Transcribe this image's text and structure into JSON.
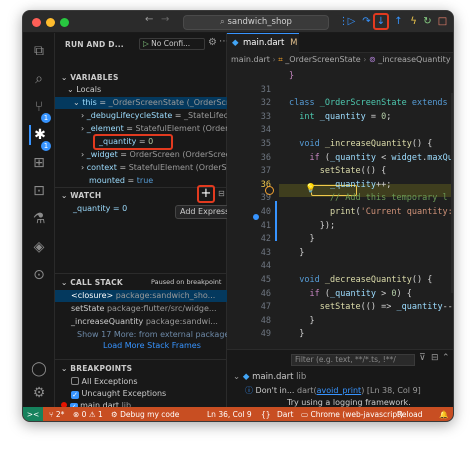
{
  "titlebar": {
    "search_text": "sandwich_shop",
    "nav_back": "←",
    "nav_forward": "→"
  },
  "sidebar": {
    "run_title": "RUN AND D...",
    "config_label": "No Confi...",
    "variables_title": "VARIABLES",
    "locals_label": "Locals",
    "variables": [
      {
        "key": "this",
        "value": "_OrderScreenState (_OrderScr..."
      },
      {
        "key": "_debugLifecycleState",
        "value": "_StateLifec..."
      },
      {
        "key": "_element",
        "value": "StatefulElement (OrderS..."
      },
      {
        "key": "_quantity",
        "value": "0"
      },
      {
        "key": "_widget",
        "value": "OrderScreen (OrderScreen)"
      },
      {
        "key": "context",
        "value": "StatefulElement (OrderScr..."
      },
      {
        "key": "mounted",
        "value": "true"
      }
    ],
    "watch_title": "WATCH",
    "watch_expr": "_quantity = 0",
    "add_expression_tooltip": "Add Expression",
    "callstack_title": "CALL STACK",
    "paused_label": "Paused on breakpoint",
    "frames": [
      {
        "fn": "<closure>",
        "loc": "package:sandwich_sho..."
      },
      {
        "fn": "setState",
        "loc": "package:flutter/src/widge..."
      },
      {
        "fn": "_increaseQuantity",
        "loc": "package:sandwi..."
      }
    ],
    "show_more": "Show 17 More: from external packages",
    "load_more": "Load More Stack Frames",
    "breakpoints_title": "BREAKPOINTS",
    "breakpoints": [
      {
        "label": "All Exceptions",
        "checked": false
      },
      {
        "label": "Uncaught Exceptions",
        "checked": true
      },
      {
        "label": "main.dart",
        "detail": "lib",
        "checked": true
      }
    ]
  },
  "editor": {
    "tab_label": "main.dart",
    "tab_badge": "M",
    "breadcrumbs": [
      "main.dart",
      "_OrderScreenState",
      "_increaseQuantity"
    ],
    "lines": [
      {
        "n": "",
        "html": "<span class='ctl'>}</span>"
      },
      {
        "n": "31",
        "html": ""
      },
      {
        "n": "32",
        "html": "<span class='kw'>class</span> <span class='ty'>_OrderScreenState</span> <span class='kw'>extends</span>"
      },
      {
        "n": "33",
        "html": "  <span class='ty'>int</span> <span class='var'>_quantity</span> = <span class='num'>0</span>;"
      },
      {
        "n": "34",
        "html": ""
      },
      {
        "n": "35",
        "html": "  <span class='kw'>void</span> <span class='fn'>_increaseQuantity</span>() {"
      },
      {
        "n": "36",
        "html": "    <span class='ctl'>if</span> (<span class='var'>_quantity</span> &lt; <span class='var'>widget</span>.<span class='var'>maxQu</span>"
      },
      {
        "n": "37",
        "html": "      <span class='fn'>setState</span>(() {"
      },
      {
        "n": "36",
        "html": "        <span class='var'>_quantity</span>++;"
      },
      {
        "n": "39",
        "html": "        <span class='cmt'>// Add this temporary l</span>"
      },
      {
        "n": "40",
        "html": "        <span class='fn'>print</span>(<span class='str'>'Current quantity:</span>"
      },
      {
        "n": "41",
        "html": "      });"
      },
      {
        "n": "42",
        "html": "    }"
      },
      {
        "n": "43",
        "html": "  }"
      },
      {
        "n": "44",
        "html": ""
      },
      {
        "n": "45",
        "html": "  <span class='kw'>void</span> <span class='fn'>_decreaseQuantity</span>() {"
      },
      {
        "n": "46",
        "html": "    <span class='ctl'>if</span> (<span class='var'>_quantity</span> &gt; <span class='num'>0</span>) {"
      },
      {
        "n": "47",
        "html": "      <span class='fn'>setState</span>(() =&gt; <span class='var'>_quantity</span>--"
      },
      {
        "n": "48",
        "html": "    }"
      },
      {
        "n": "49",
        "html": "  }"
      }
    ]
  },
  "panel": {
    "filter_placeholder": "Filter (e.g. text, **/*.ts, !**/",
    "problem_file": "main.dart",
    "problem_file_detail": "lib",
    "problem_msg": "Don't in...",
    "problem_source": "dart(",
    "problem_rule": "avoid_print",
    "problem_location": ") [Ln 38, Col 9]",
    "problem_hint": "Try using a logging framework."
  },
  "statusbar": {
    "remote": "><",
    "branch": "2*",
    "errors": "0",
    "warnings": "1",
    "debug": "Debug my code",
    "position": "Ln 36, Col 9",
    "language": "Dart",
    "device": "Chrome (web-javascript)",
    "reload": "Reload"
  },
  "colors": {
    "accent": "#3794ff",
    "status_bar": "#c84e22",
    "highlight": "#e23a1f",
    "breakpoint": "#e51400"
  }
}
